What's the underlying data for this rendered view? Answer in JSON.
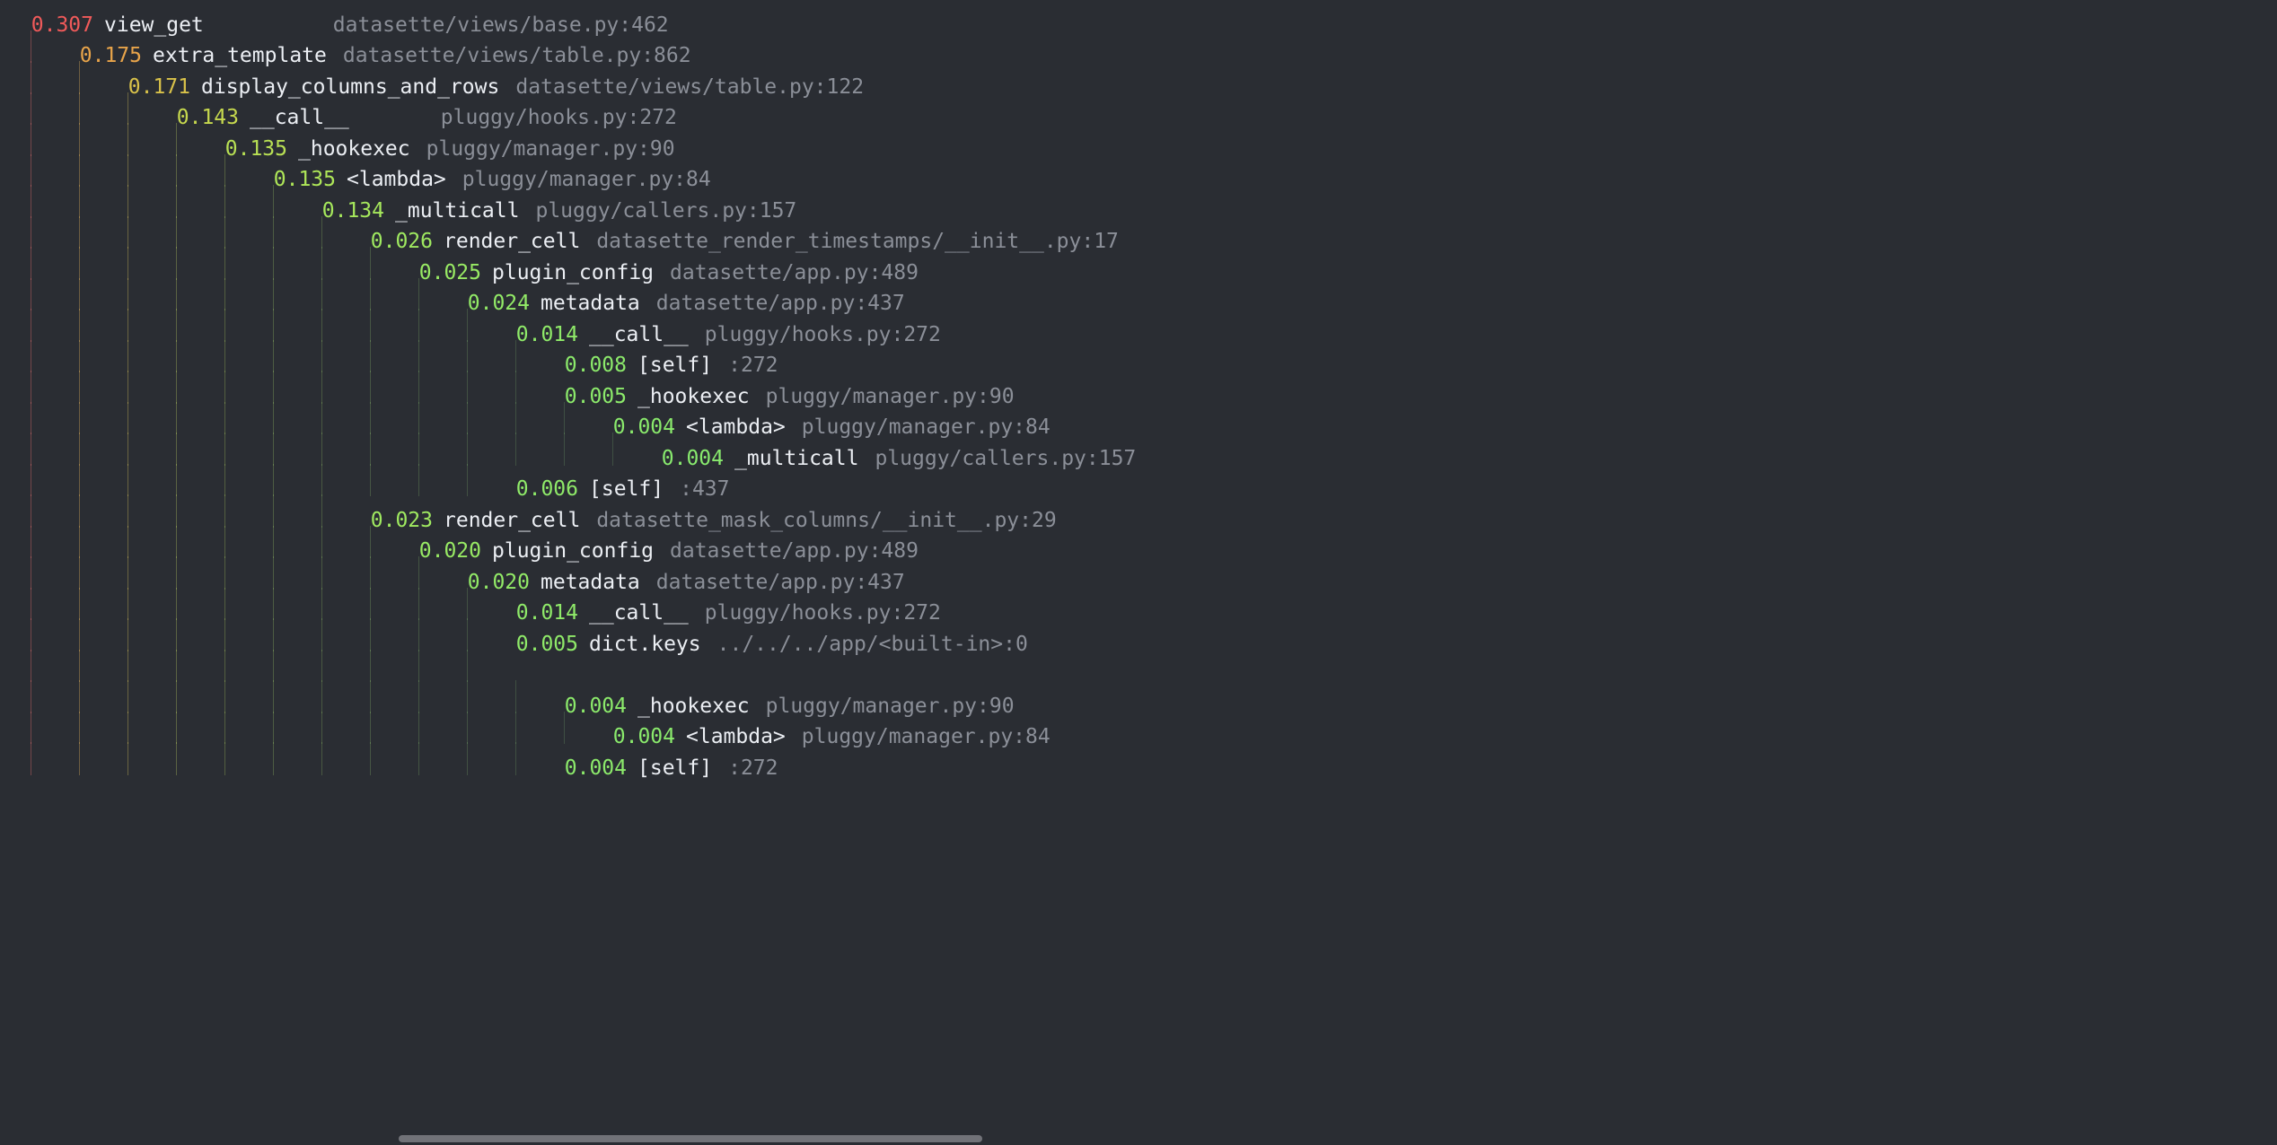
{
  "colors": {
    "heat0": "#f05a5a",
    "heat1": "#e8a44a",
    "heat2": "#d9c24a",
    "heat3": "#c6d84e",
    "heat4": "#b8e054",
    "heat5": "#aee658",
    "heat6": "#a6e85c",
    "heat7": "#9fe960",
    "heat8": "#98ea64",
    "heat9": "#92ea67",
    "heat10": "#8fea69",
    "heat11": "#8cea6b",
    "heat12": "#8aea6c",
    "heat13": "#88ea6e"
  },
  "rows": [
    {
      "depth": 0,
      "time": "0.307",
      "name": "view_get",
      "namePad": 9,
      "loc": "datasette/views/base.py:462"
    },
    {
      "depth": 1,
      "time": "0.175",
      "name": "extra_template",
      "namePad": 0,
      "loc": "datasette/views/table.py:862"
    },
    {
      "depth": 2,
      "time": "0.171",
      "name": "display_columns_and_rows",
      "namePad": 0,
      "loc": "datasette/views/table.py:122"
    },
    {
      "depth": 3,
      "time": "0.143",
      "name": "__call__",
      "namePad": 6,
      "loc": "pluggy/hooks.py:272"
    },
    {
      "depth": 4,
      "time": "0.135",
      "name": "_hookexec",
      "namePad": 0,
      "loc": "pluggy/manager.py:90"
    },
    {
      "depth": 5,
      "time": "0.135",
      "name": "<lambda>",
      "namePad": 0,
      "loc": "pluggy/manager.py:84"
    },
    {
      "depth": 6,
      "time": "0.134",
      "name": "_multicall",
      "namePad": 0,
      "loc": "pluggy/callers.py:157"
    },
    {
      "depth": 7,
      "time": "0.026",
      "name": "render_cell",
      "namePad": 0,
      "loc": "datasette_render_timestamps/__init__.py:17"
    },
    {
      "depth": 8,
      "time": "0.025",
      "name": "plugin_config",
      "namePad": 0,
      "loc": "datasette/app.py:489"
    },
    {
      "depth": 9,
      "time": "0.024",
      "name": "metadata",
      "namePad": 0,
      "loc": "datasette/app.py:437"
    },
    {
      "depth": 10,
      "time": "0.014",
      "name": "__call__",
      "namePad": 0,
      "loc": "pluggy/hooks.py:272"
    },
    {
      "depth": 11,
      "time": "0.008",
      "name": "[self]",
      "namePad": 0,
      "loc": ":272"
    },
    {
      "depth": 11,
      "time": "0.005",
      "name": "_hookexec",
      "namePad": 0,
      "loc": "pluggy/manager.py:90"
    },
    {
      "depth": 12,
      "time": "0.004",
      "name": "<lambda>",
      "namePad": 0,
      "loc": "pluggy/manager.py:84"
    },
    {
      "depth": 13,
      "time": "0.004",
      "name": "_multicall",
      "namePad": 0,
      "loc": "pluggy/callers.py:157"
    },
    {
      "depth": 10,
      "time": "0.006",
      "name": "[self]",
      "namePad": 0,
      "loc": ":437"
    },
    {
      "depth": 7,
      "time": "0.023",
      "name": "render_cell",
      "namePad": 0,
      "loc": "datasette_mask_columns/__init__.py:29"
    },
    {
      "depth": 8,
      "time": "0.020",
      "name": "plugin_config",
      "namePad": 0,
      "loc": "datasette/app.py:489"
    },
    {
      "depth": 9,
      "time": "0.020",
      "name": "metadata",
      "namePad": 0,
      "loc": "datasette/app.py:437"
    },
    {
      "depth": 10,
      "time": "0.014",
      "name": "__call__",
      "namePad": 0,
      "loc": "pluggy/hooks.py:272"
    },
    {
      "depth": 10,
      "time": "0.005",
      "name": "dict.keys",
      "namePad": 0,
      "loc": "../../../app/<built-in>:0",
      "locWrap": 29
    },
    {
      "depth": 11,
      "time": "0.004",
      "name": "_hookexec",
      "namePad": 0,
      "loc": "pluggy/manager.py:90"
    },
    {
      "depth": 12,
      "time": "0.004",
      "name": "<lambda>",
      "namePad": 0,
      "loc": "pluggy/manager.py:84"
    },
    {
      "depth": 11,
      "time": "0.004",
      "name": "[self]",
      "namePad": 0,
      "loc": ":272"
    }
  ]
}
